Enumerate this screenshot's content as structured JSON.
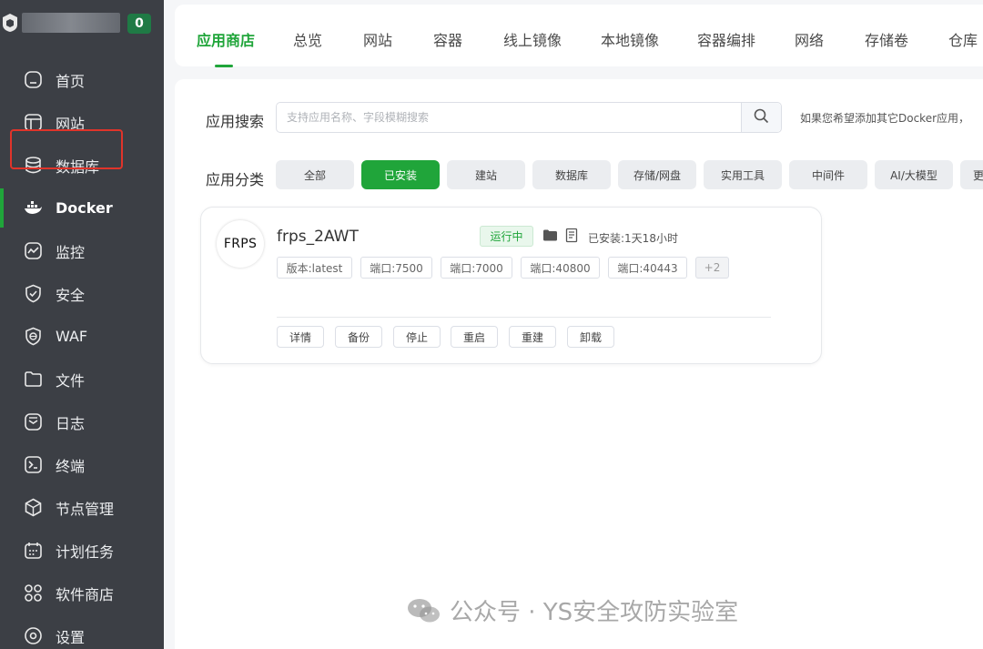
{
  "sidebar": {
    "badge": "0",
    "items": [
      {
        "label": "首页",
        "icon": "home-icon"
      },
      {
        "label": "网站",
        "icon": "website-icon"
      },
      {
        "label": "数据库",
        "icon": "database-icon"
      },
      {
        "label": "Docker",
        "icon": "docker-icon"
      },
      {
        "label": "监控",
        "icon": "monitor-icon"
      },
      {
        "label": "安全",
        "icon": "shield-icon"
      },
      {
        "label": "WAF",
        "icon": "waf-icon"
      },
      {
        "label": "文件",
        "icon": "folder-icon"
      },
      {
        "label": "日志",
        "icon": "log-icon"
      },
      {
        "label": "终端",
        "icon": "terminal-icon"
      },
      {
        "label": "节点管理",
        "icon": "node-icon"
      },
      {
        "label": "计划任务",
        "icon": "calendar-icon"
      },
      {
        "label": "软件商店",
        "icon": "apps-icon"
      },
      {
        "label": "设置",
        "icon": "settings-icon"
      }
    ]
  },
  "tabs": [
    "应用商店",
    "总览",
    "网站",
    "容器",
    "线上镜像",
    "本地镜像",
    "容器编排",
    "网络",
    "存储卷",
    "仓库"
  ],
  "search": {
    "label": "应用搜索",
    "placeholder": "支持应用名称、字段模糊搜索",
    "hint": "如果您希望添加其它Docker应用，"
  },
  "categories": {
    "label": "应用分类",
    "items": [
      "全部",
      "已安装",
      "建站",
      "数据库",
      "存储/网盘",
      "实用工具",
      "中间件",
      "AI/大模型",
      "更"
    ]
  },
  "app_card": {
    "logo_text": "FRPS",
    "name": "frps_2AWT",
    "status": "运行中",
    "installed": "已安装:1天18小时",
    "tags": [
      "版本:latest",
      "端口:7500",
      "端口:7000",
      "端口:40800",
      "端口:40443",
      "+2"
    ],
    "actions": [
      "详情",
      "备份",
      "停止",
      "重启",
      "重建",
      "卸载"
    ]
  },
  "watermark": "公众号 · YS安全攻防实验室",
  "colors": {
    "accent": "#20a53a",
    "sidebar_bg": "#3c3f45",
    "highlight_frame": "#e0342a"
  }
}
